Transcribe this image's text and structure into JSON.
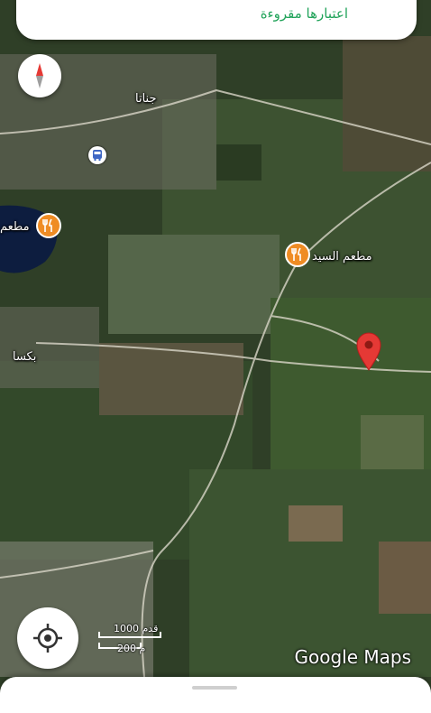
{
  "top_card": {
    "text": "اعتبارها مقروءة"
  },
  "map": {
    "places": {
      "town_north": "جناتا",
      "town_west": "بكسا",
      "restaurant_west": "مطعم",
      "restaurant_sayed": "مطعم السيد"
    },
    "icons": {
      "compass": "compass-icon",
      "restaurant": "fork-knife-icon",
      "bus": "bus-stop-icon",
      "pin": "location-pin-icon",
      "locate": "my-location-icon"
    },
    "colors": {
      "poi": "#ef8c24",
      "pin": "#e53935",
      "accent_text": "#21a35a"
    }
  },
  "scale": {
    "feet": "1000 قدم",
    "meters": "200 م"
  },
  "attribution": "Google Maps"
}
